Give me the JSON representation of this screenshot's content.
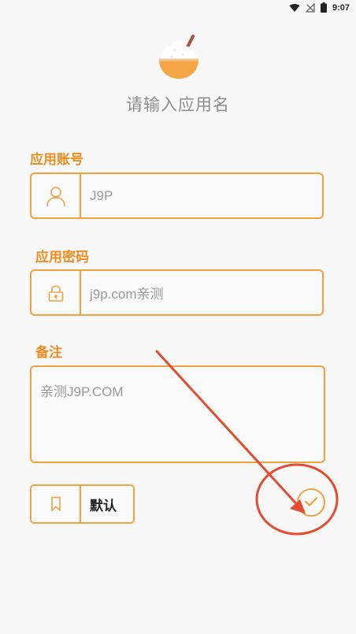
{
  "status_bar": {
    "time": "9:07",
    "icons": [
      "wifi-icon",
      "no-signal-icon",
      "battery-icon"
    ]
  },
  "header": {
    "icon": "rice-bowl-icon",
    "title": "请输入应用名"
  },
  "account": {
    "label": "应用账号",
    "value": "J9P",
    "icon": "user-icon"
  },
  "password": {
    "label": "应用密码",
    "value": "j9p.com亲测",
    "icon": "lock-icon"
  },
  "note": {
    "label": "备注",
    "value": "亲测J9P.COM"
  },
  "default_button": {
    "label": "默认",
    "icon": "bookmark-icon"
  },
  "confirm_button": {
    "icon": "check-icon"
  },
  "colors": {
    "accent": "#f08c1e",
    "border": "#f3a13f",
    "annotation": "#e54b2f",
    "background": "#f8f8f8"
  }
}
